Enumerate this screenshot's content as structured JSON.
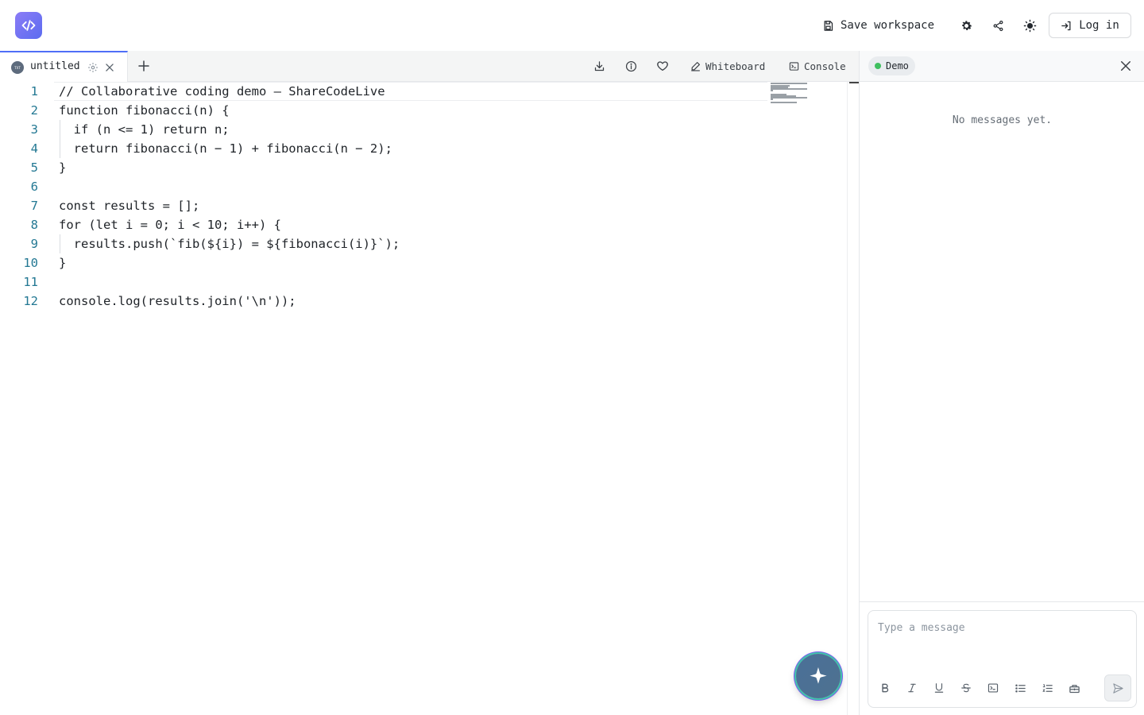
{
  "header": {
    "logo_icon": "code-brackets-icon",
    "save_label": "Save workspace",
    "login_label": "Log in"
  },
  "tabs": [
    {
      "label": "untitled",
      "lang_badge": "TXT"
    }
  ],
  "toolbar": {
    "whiteboard_label": "Whiteboard",
    "console_label": "Console"
  },
  "editor": {
    "lines": [
      {
        "n": "1",
        "code": "// Collaborative coding demo – ShareCodeLive"
      },
      {
        "n": "2",
        "code": "function fibonacci(n) {"
      },
      {
        "n": "3",
        "code": "  if (n <= 1) return n;"
      },
      {
        "n": "4",
        "code": "  return fibonacci(n − 1) + fibonacci(n − 2);"
      },
      {
        "n": "5",
        "code": "}"
      },
      {
        "n": "6",
        "code": ""
      },
      {
        "n": "7",
        "code": "const results = [];"
      },
      {
        "n": "8",
        "code": "for (let i = 0; i < 10; i++) {"
      },
      {
        "n": "9",
        "code": "  results.push(`fib(${i}) = ${fibonacci(i)}`);"
      },
      {
        "n": "10",
        "code": "}"
      },
      {
        "n": "11",
        "code": ""
      },
      {
        "n": "12",
        "code": "console.log(results.join('\\n'));"
      }
    ]
  },
  "chat": {
    "room_label": "Demo",
    "empty_text": "No messages yet.",
    "input_placeholder": "Type a message"
  },
  "colors": {
    "accent": "#4f6ef7",
    "line_number": "#237893",
    "online": "#3fbf5f"
  }
}
